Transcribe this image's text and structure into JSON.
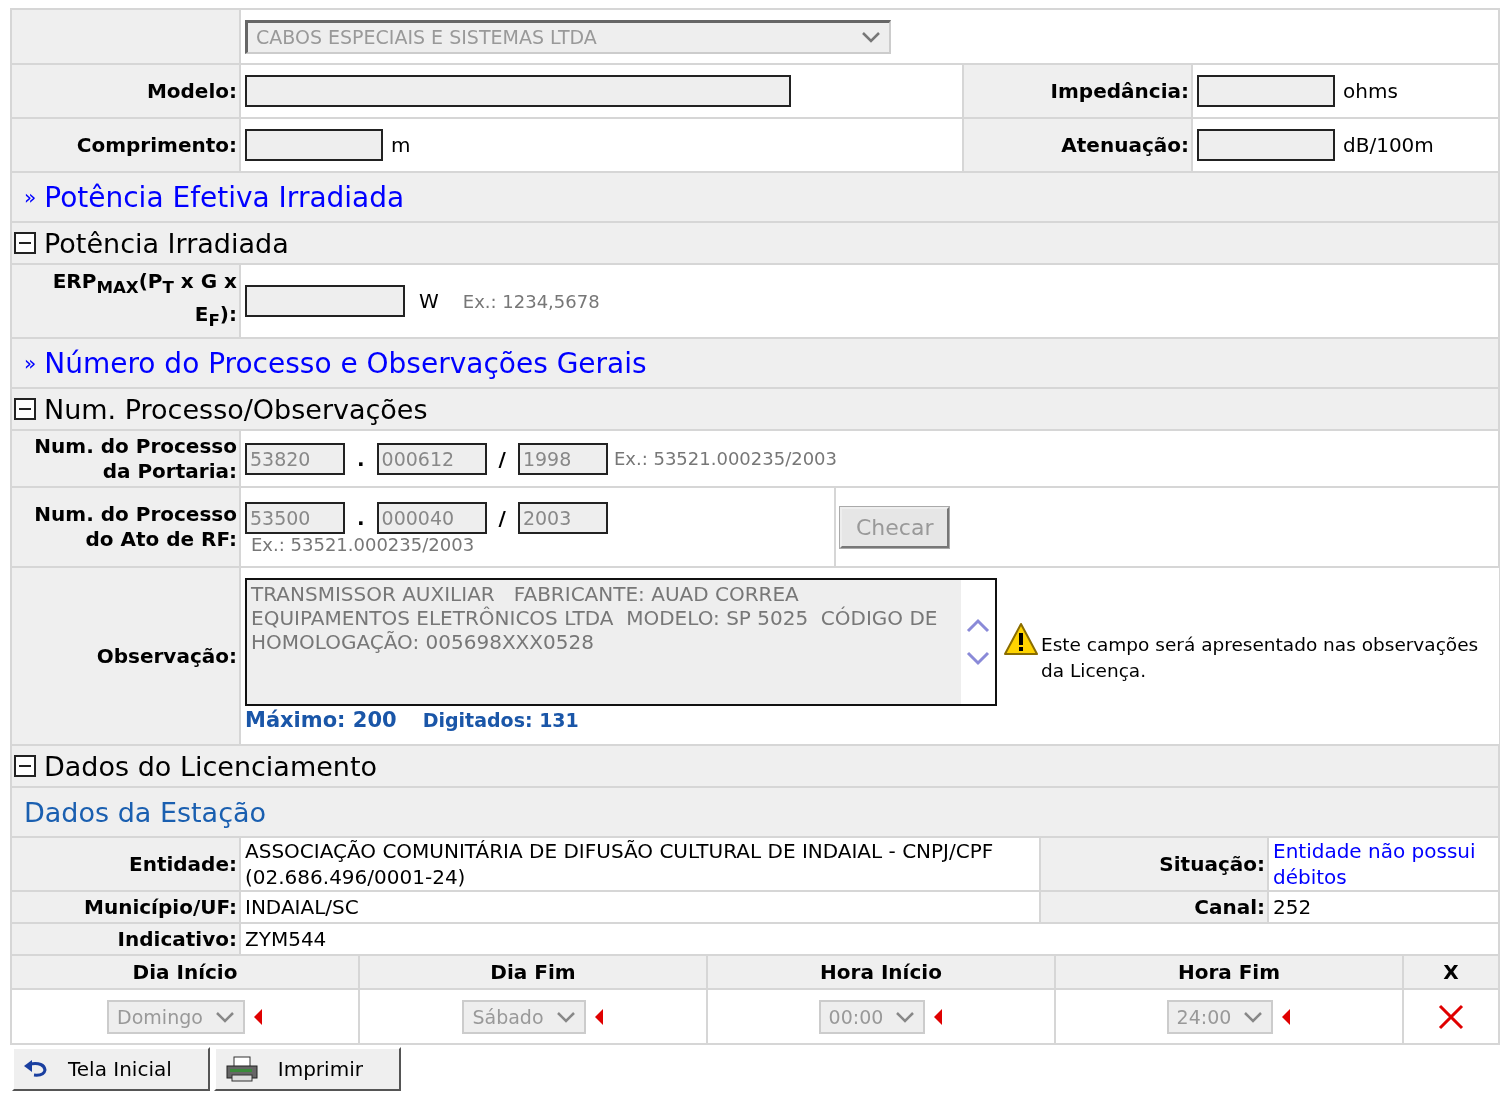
{
  "cable": {
    "manufacturer": {
      "value": "CABOS ESPECIAIS E SISTEMAS LTDA",
      "disabled": true
    },
    "rows": [
      [
        {
          "label": "Modelo:",
          "kind": "long"
        },
        {
          "label": "Impedância:",
          "kind": "short",
          "unit": "ohms"
        }
      ],
      [
        {
          "label": "Comprimento:",
          "kind": "short",
          "unit": "m"
        },
        {
          "label": "Atenuação:",
          "kind": "short",
          "unit": "dB/100m"
        }
      ]
    ]
  },
  "power_link": {
    "marker": "»",
    "text": "Potência Efetiva Irradiada"
  },
  "power": {
    "header": {
      "title": "Potência Irradiada",
      "expanded": true
    },
    "erp": {
      "label": "ERP$_{MAX}$(P$_{T}$ x G x E$_{F}$):",
      "unit": "W",
      "example": "Ex.: 1234,5678"
    }
  },
  "process_link": {
    "marker": "»",
    "text": "Número do Processo e Observações Gerais"
  },
  "process": {
    "header": {
      "title": "Num. Processo/Observações",
      "expanded": true
    },
    "numbers": [
      {
        "label": "Num. do Processo da Portaria:",
        "parts": [
          "53820",
          "000612",
          "1998"
        ],
        "separators": [
          ".",
          "/"
        ],
        "example": "Ex.: 53521.000235/2003"
      },
      {
        "label": "Num. do Processo do Ato de RF:",
        "parts": [
          "53500",
          "000040",
          "2003"
        ],
        "separators": [
          ".",
          "/"
        ],
        "example": "Ex.: 53521.000235/2003",
        "button": {
          "label": "Checar",
          "disabled": true
        }
      }
    ],
    "observation": {
      "label": "Observação:",
      "value": "TRANSMISSOR AUXILIAR   FABRICANTE: AUAD CORREA EQUIPAMENTOS ELETRÔNICOS LTDA  MODELO: SP 5025  CÓDIGO DE HOMOLOGAÇÃO: 005698XXX0528",
      "max": "Máximo: 200",
      "typed": "Digitados: 131",
      "notice": "Este campo será apresentado nas observações da Licença."
    }
  },
  "licensing": {
    "header": {
      "title": "Dados do Licenciamento",
      "expanded": true
    },
    "station_title": "Dados da Estação",
    "station": [
      [
        {
          "label": "Entidade:",
          "value": "ASSOCIAÇÃO COMUNITÁRIA DE DIFUSÃO CULTURAL DE INDAIAL - CNPJ/CPF (02.686.496/0001-24)"
        },
        {
          "label": "Situação:",
          "value": "Entidade não possui débitos",
          "kind": "link"
        }
      ],
      [
        {
          "label": "Município/UF:",
          "value": "INDAIAL/SC"
        },
        {
          "label": "Canal:",
          "value": "252"
        }
      ],
      [
        {
          "label": "Indicativo:",
          "value": "ZYM544"
        }
      ]
    ],
    "schedule": {
      "columns": [
        "Dia Início",
        "Dia Fim",
        "Hora Início",
        "Hora Fim",
        "X"
      ],
      "rows": [
        {
          "cells": [
            {
              "value": "Domingo",
              "disabled": true,
              "required": true
            },
            {
              "value": "Sábado",
              "disabled": true,
              "required": true
            },
            {
              "value": "00:00",
              "disabled": true,
              "required": true
            },
            {
              "value": "24:00",
              "disabled": true,
              "required": true
            }
          ]
        }
      ]
    }
  },
  "buttons": [
    {
      "label": "Tela Inicial",
      "kind": "home"
    },
    {
      "label": "Imprimir",
      "kind": "print"
    }
  ]
}
